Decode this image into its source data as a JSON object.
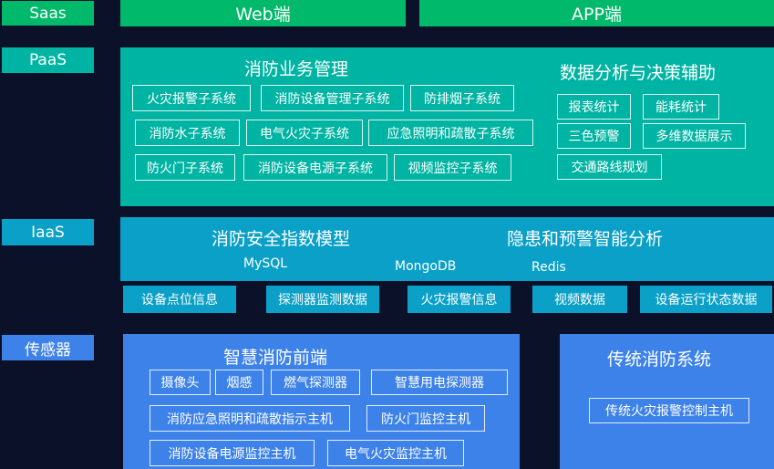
{
  "colors": {
    "background": "#0a1128",
    "saas_green": "#00b96b",
    "paas_teal": "#00b4a3",
    "iaas_blue": "#0aa0c8",
    "sensor_blue": "#3d82e8"
  },
  "layers": {
    "saas": "Saas",
    "paas": "PaaS",
    "iaas": "IaaS",
    "sensor": "传感器"
  },
  "saas": {
    "web": "Web端",
    "app": "APP端"
  },
  "paas": {
    "business_title": "消防业务管理",
    "business_items": [
      "火灾报警子系统",
      "消防设备管理子系统",
      "防排烟子系统",
      "消防水子系统",
      "电气火灾子系统",
      "应急照明和疏散子系统",
      "防火门子系统",
      "消防设备电源子系统",
      "视频监控子系统"
    ],
    "analysis_title": "数据分析与决策辅助",
    "analysis_items": [
      "报表统计",
      "能耗统计",
      "三色预警",
      "多维数据展示",
      "交通路线规划"
    ]
  },
  "iaas": {
    "model_title": "消防安全指数模型",
    "analysis_title": "隐患和预警智能分析",
    "databases": [
      "MySQL",
      "MongoDB",
      "Redis"
    ],
    "data_items": [
      "设备点位信息",
      "探测器监测数据",
      "火灾报警信息",
      "视频数据",
      "设备运行状态数据"
    ]
  },
  "sensor": {
    "frontend_title": "智慧消防前端",
    "frontend_items": [
      "摄像头",
      "烟感",
      "燃气探测器",
      "智慧用电探测器",
      "消防应急照明和疏散指示主机",
      "防火门监控主机",
      "消防设备电源监控主机",
      "电气火灾监控主机"
    ],
    "traditional_title": "传统消防系统",
    "traditional_items": [
      "传统火灾报警控制主机"
    ]
  }
}
